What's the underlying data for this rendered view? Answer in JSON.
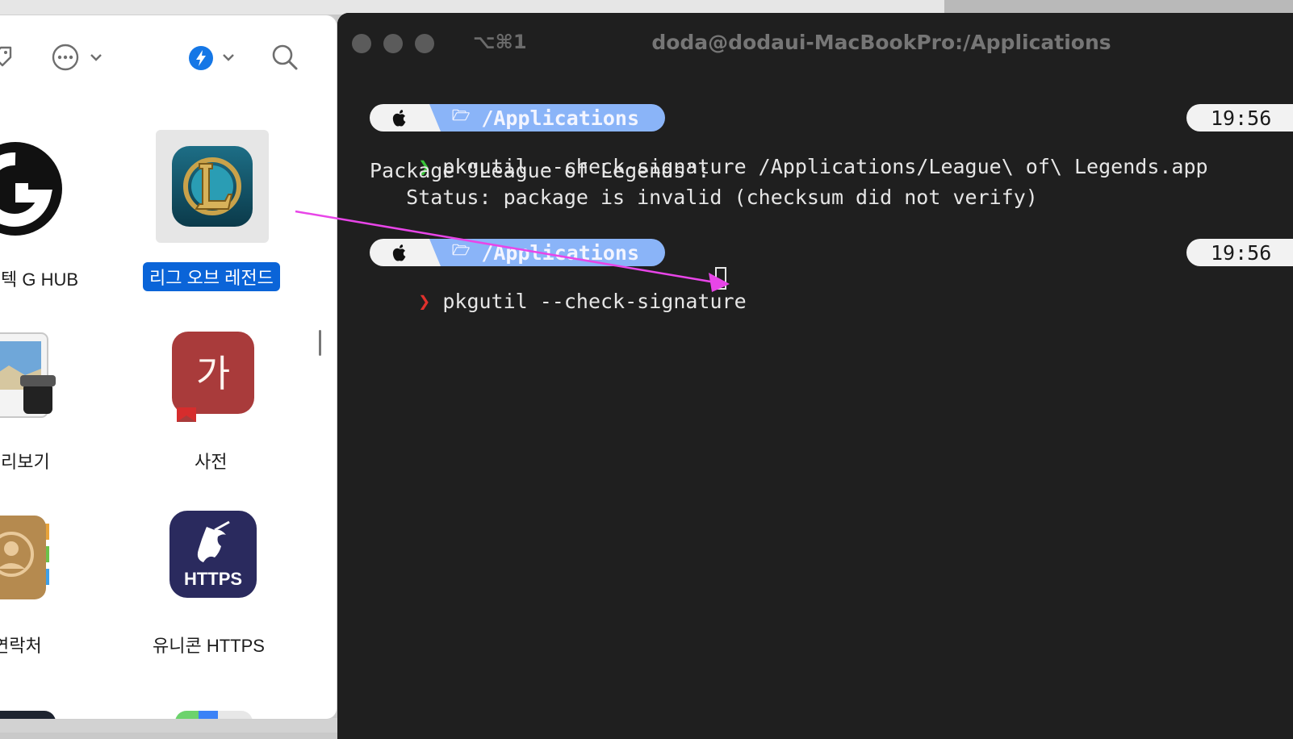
{
  "finder": {
    "apps": [
      {
        "label": "로지텍 G HUB",
        "visible_label": "텍 G HUB",
        "icon": "logitech-g-hub-icon"
      },
      {
        "label": "리그 오브 레전드",
        "icon": "league-of-legends-icon",
        "selected": true
      },
      {
        "label": "미리보기",
        "visible_label": "리보기",
        "icon": "preview-icon"
      },
      {
        "label": "사전",
        "icon": "dictionary-icon",
        "glyph": "가"
      },
      {
        "label": "연락처",
        "visible_label": "연락처",
        "icon": "contacts-icon"
      },
      {
        "label": "유니콘 HTTPS",
        "icon": "unicorn-https-icon",
        "badge": "HTTPS"
      }
    ],
    "toolbar": [
      "tag-icon",
      "more-actions-icon",
      "chevron-down-icon",
      "shortcuts-icon",
      "chevron-down-icon",
      "search-icon"
    ]
  },
  "terminal": {
    "shortcut": "⌥⌘1",
    "title": "doda@dodaui-MacBookPro:/Applications",
    "prompts": [
      {
        "path": "/Applications",
        "time": "19:56",
        "command": "pkgutil --check-signature /Applications/League\\ of\\ Legends.app",
        "status": "ok"
      },
      {
        "path": "/Applications",
        "time": "19:56",
        "command": "pkgutil --check-signature",
        "status": "error"
      }
    ],
    "output": [
      "Package \"League of Legends\":",
      "   Status: package is invalid (checksum did not verify)"
    ],
    "chevron": "❯",
    "folder_glyph": "🗁"
  },
  "annotation": {
    "arrow_color": "#e845e8"
  }
}
